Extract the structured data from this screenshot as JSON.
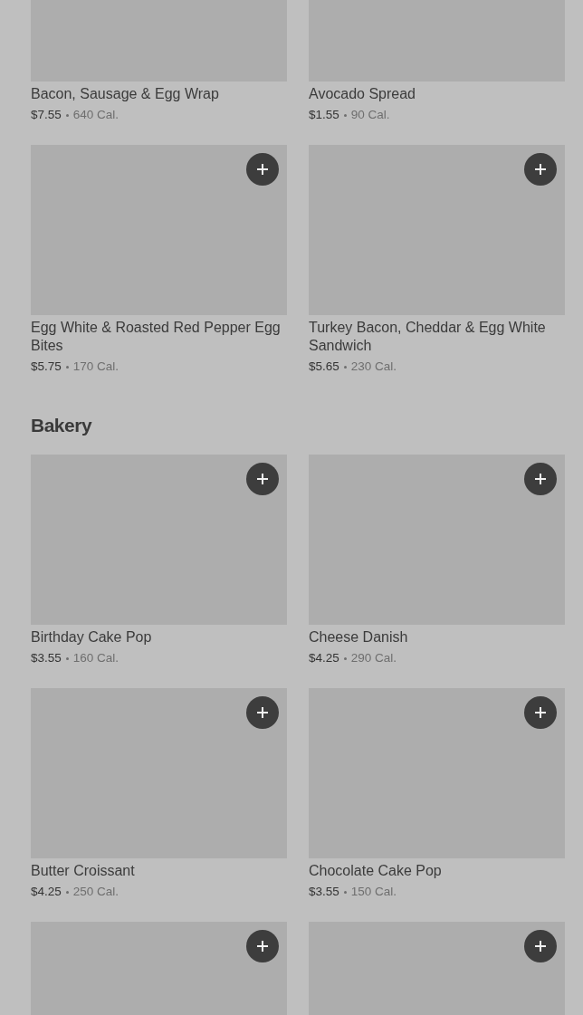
{
  "sections": [
    {
      "items": [
        {
          "name": "Bacon, Sausage & Egg Wrap",
          "price": "$7.55",
          "calories": "640 Cal."
        },
        {
          "name": "Avocado Spread",
          "price": "$1.55",
          "calories": "90 Cal."
        },
        {
          "name": "Egg White & Roasted Red Pepper Egg Bites",
          "price": "$5.75",
          "calories": "170 Cal.",
          "add_button": true
        },
        {
          "name": "Turkey Bacon, Cheddar & Egg White Sandwich",
          "price": "$5.65",
          "calories": "230 Cal.",
          "add_button": true
        }
      ]
    },
    {
      "title": "Bakery",
      "items": [
        {
          "name": "Birthday Cake Pop",
          "price": "$3.55",
          "calories": "160 Cal.",
          "add_button": true
        },
        {
          "name": "Cheese Danish",
          "price": "$4.25",
          "calories": "290 Cal.",
          "add_button": true
        },
        {
          "name": "Butter Croissant",
          "price": "$4.25",
          "calories": "250 Cal.",
          "add_button": true
        },
        {
          "name": "Chocolate Cake Pop",
          "price": "$3.55",
          "calories": "150 Cal.",
          "add_button": true
        },
        {
          "add_button": true
        },
        {
          "add_button": true
        }
      ]
    }
  ]
}
